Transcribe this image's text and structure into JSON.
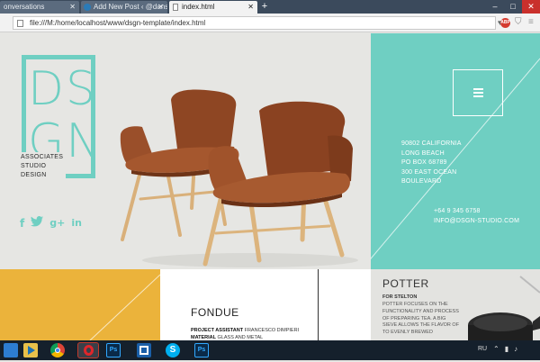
{
  "browser": {
    "tabs": [
      {
        "label": "onversations",
        "active": false
      },
      {
        "label": "Add New Post ‹ @danskho",
        "active": false
      },
      {
        "label": "index.html",
        "active": true
      }
    ],
    "new_tab": "+",
    "window_controls": {
      "minimize": "–",
      "maximize": "□",
      "close": "✕"
    },
    "url": "file:///M:/home/localhost/www/dsgn-template/index.html",
    "extension_badge": "ABP"
  },
  "site": {
    "logo": {
      "line1": "DS",
      "line2": "GN"
    },
    "tagline": [
      "ASSOCIATES",
      "STUDIO",
      "DESIGN"
    ],
    "social": [
      {
        "name": "facebook-icon",
        "glyph": "f"
      },
      {
        "name": "twitter-icon",
        "glyph": "t"
      },
      {
        "name": "googleplus-icon",
        "glyph": "g+"
      },
      {
        "name": "linkedin-icon",
        "glyph": "in"
      }
    ],
    "address": [
      "90802 CALIFORNIA",
      "LONG BEACH",
      "PO BOX 68789",
      "300 EAST OCEAN",
      "BOULEVARD"
    ],
    "contact": [
      "+64 9 345 6758",
      "INFO@DSGN-STUDIO.COM"
    ],
    "colors": {
      "teal": "#6fcfc2",
      "yellow": "#ebb33b",
      "leather": "#9a4f2a",
      "wood": "#d9b07a"
    }
  },
  "tiles": {
    "fondue": {
      "title": "FONDUE",
      "meta": [
        {
          "label": "PROJECT ASSISTANT",
          "value": "FRANCESCO DIMPIERI"
        },
        {
          "label": "MATERIAL",
          "value": "GLASS AND METAL"
        }
      ]
    },
    "potter": {
      "title": "POTTER",
      "for_label": "FOR STELTON",
      "description": "POTTER FOCUSES ON THE FUNCTIONALITY AND PROCESS OF PREPARING TEA. A BIG SIEVE ALLOWS THE FLAVOR OF TO EVENLY BREWED"
    }
  },
  "taskbar": {
    "apps": [
      "windows-start",
      "file-explorer",
      "media-player",
      "chrome",
      "opera",
      "photoshop",
      "app-window",
      "skype",
      "photoshop-2"
    ],
    "language": "RU"
  }
}
